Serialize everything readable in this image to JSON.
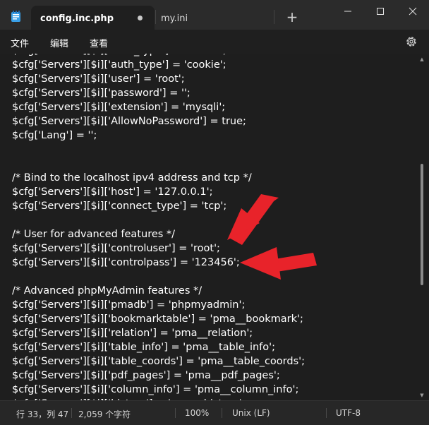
{
  "tabs": [
    {
      "label": "config.inc.php",
      "unsaved": true
    },
    {
      "label": "my.ini"
    }
  ],
  "new_tab_label": "+",
  "menu": [
    "文件",
    "编辑",
    "查看"
  ],
  "icons": {
    "app": "notepad-icon",
    "settings": "gear-icon",
    "minimize": "minimize-icon",
    "maximize": "maximize-icon",
    "close": "close-icon"
  },
  "editor": {
    "lines": [
      "$cfg['Servers'][$i]['auth_type'] = 'cookie';",
      "$cfg['Servers'][$i]['auth_type'] = 'cookie';",
      "$cfg['Servers'][$i]['user'] = 'root';",
      "$cfg['Servers'][$i]['password'] = '';",
      "$cfg['Servers'][$i]['extension'] = 'mysqli';",
      "$cfg['Servers'][$i]['AllowNoPassword'] = true;",
      "$cfg['Lang'] = '';",
      "",
      "",
      "/* Bind to the localhost ipv4 address and tcp */",
      "$cfg['Servers'][$i]['host'] = '127.0.0.1';",
      "$cfg['Servers'][$i]['connect_type'] = 'tcp';",
      "",
      "/* User for advanced features */",
      "$cfg['Servers'][$i]['controluser'] = 'root';",
      "$cfg['Servers'][$i]['controlpass'] = '123456';",
      "",
      "/* Advanced phpMyAdmin features */",
      "$cfg['Servers'][$i]['pmadb'] = 'phpmyadmin';",
      "$cfg['Servers'][$i]['bookmarktable'] = 'pma__bookmark';",
      "$cfg['Servers'][$i]['relation'] = 'pma__relation';",
      "$cfg['Servers'][$i]['table_info'] = 'pma__table_info';",
      "$cfg['Servers'][$i]['table_coords'] = 'pma__table_coords';",
      "$cfg['Servers'][$i]['pdf_pages'] = 'pma__pdf_pages';",
      "$cfg['Servers'][$i]['column_info'] = 'pma__column_info';",
      "$cfg['Servers'][$i]['history'] = 'pma__history';"
    ]
  },
  "status": {
    "position": "行 33，列 47",
    "char_count": "2,059 个字符",
    "zoom": "100%",
    "line_ending": "Unix (LF)",
    "encoding": "UTF-8"
  },
  "colors": {
    "annotation_arrow": "#e8232a"
  }
}
